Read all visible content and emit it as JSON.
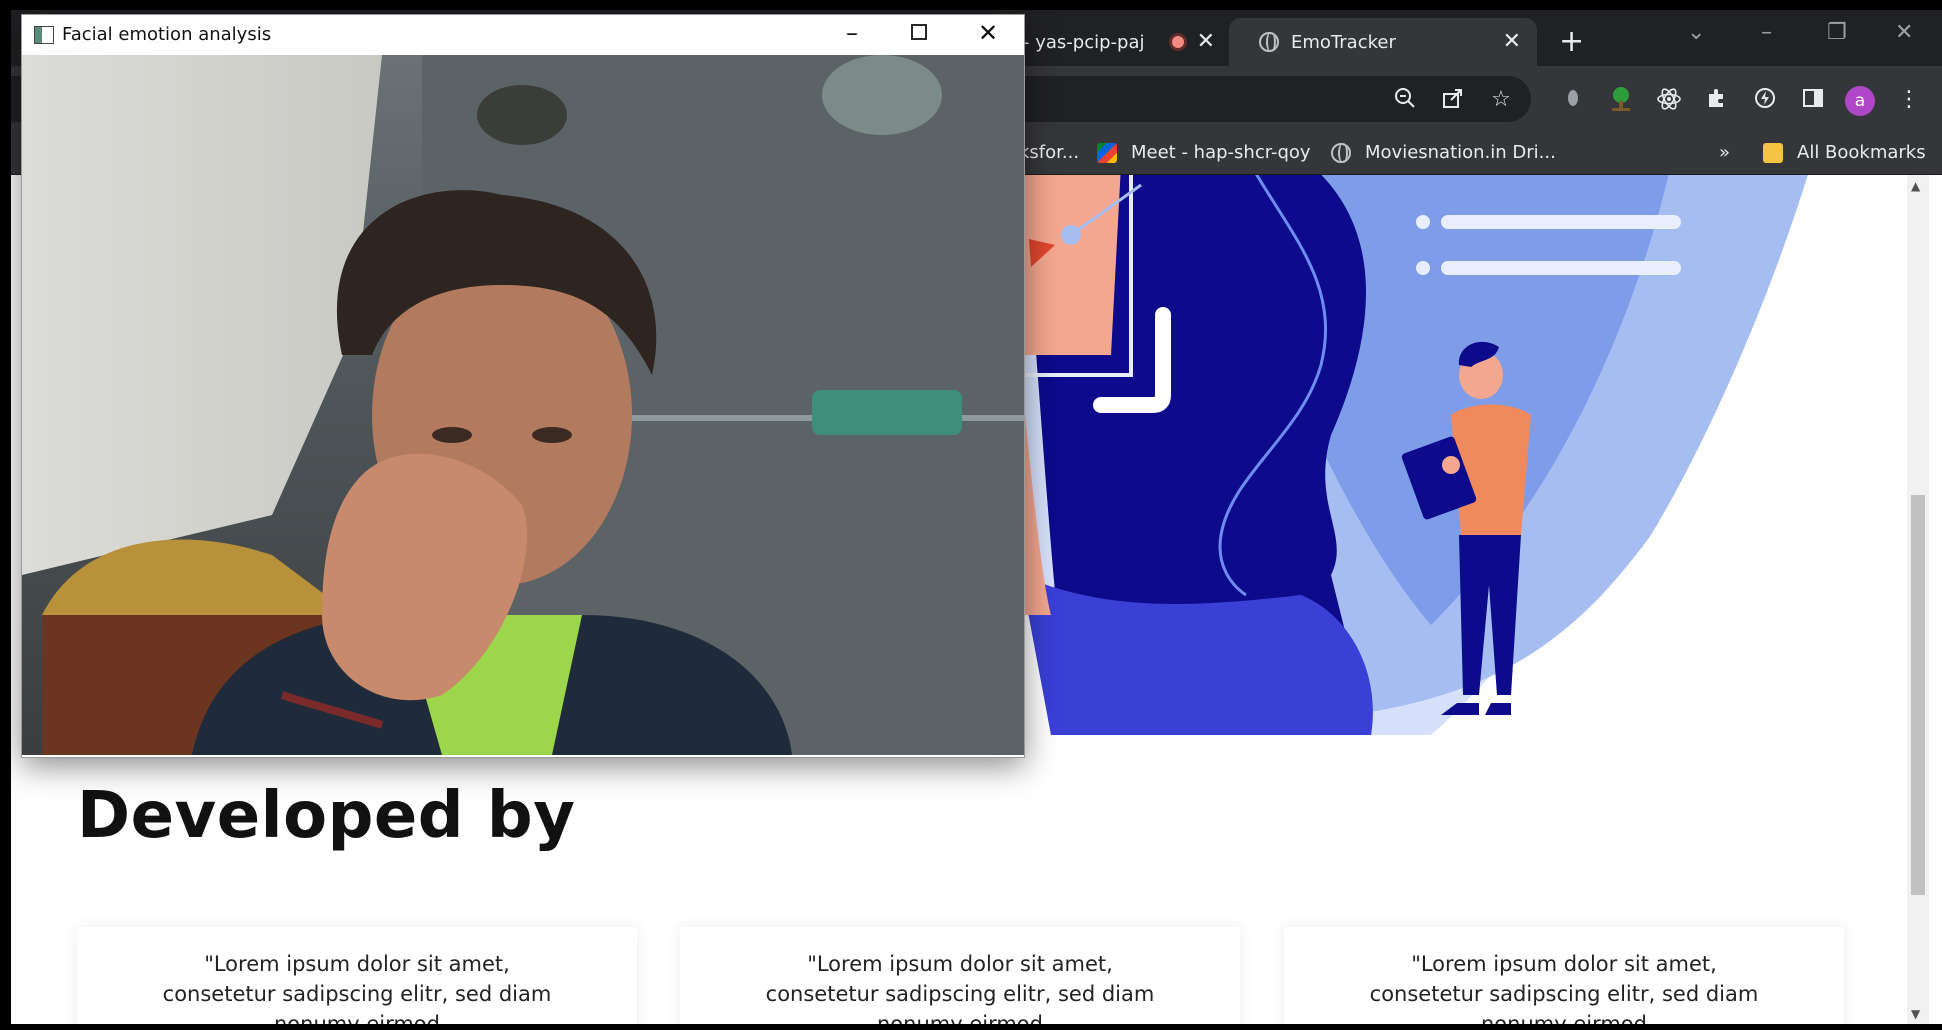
{
  "browser": {
    "tabs": [
      {
        "label": "- yas-pcip-paj"
      },
      {
        "label": "EmoTracker"
      }
    ],
    "new_tab_label": "+",
    "avatar_letter": "a",
    "bookmarks": [
      {
        "label": "ksfor..."
      },
      {
        "label": "Meet - hap-shcr-qoy"
      },
      {
        "label": "Moviesnation.in Dri..."
      }
    ],
    "bookmarks_overflow": "»",
    "all_bookmarks": "All Bookmarks"
  },
  "page": {
    "section_title": "Developed by",
    "cards": [
      {
        "text": "\"Lorem ipsum dolor sit amet, consetetur sadipscing elitr, sed diam nonumy eirmod"
      },
      {
        "text": "\"Lorem ipsum dolor sit amet, consetetur sadipscing elitr, sed diam nonumy eirmod"
      },
      {
        "text": "\"Lorem ipsum dolor sit amet, consetetur sadipscing elitr, sed diam nonumy eirmod"
      }
    ]
  },
  "camera_window": {
    "title": "Facial emotion analysis"
  },
  "colors": {
    "navy": "#0d0a8c",
    "light_blue": "#a6bdf2",
    "pale_blue": "#d6e0fa",
    "accent_orange": "#f08a5d",
    "purple_avatar": "#b047c9"
  }
}
